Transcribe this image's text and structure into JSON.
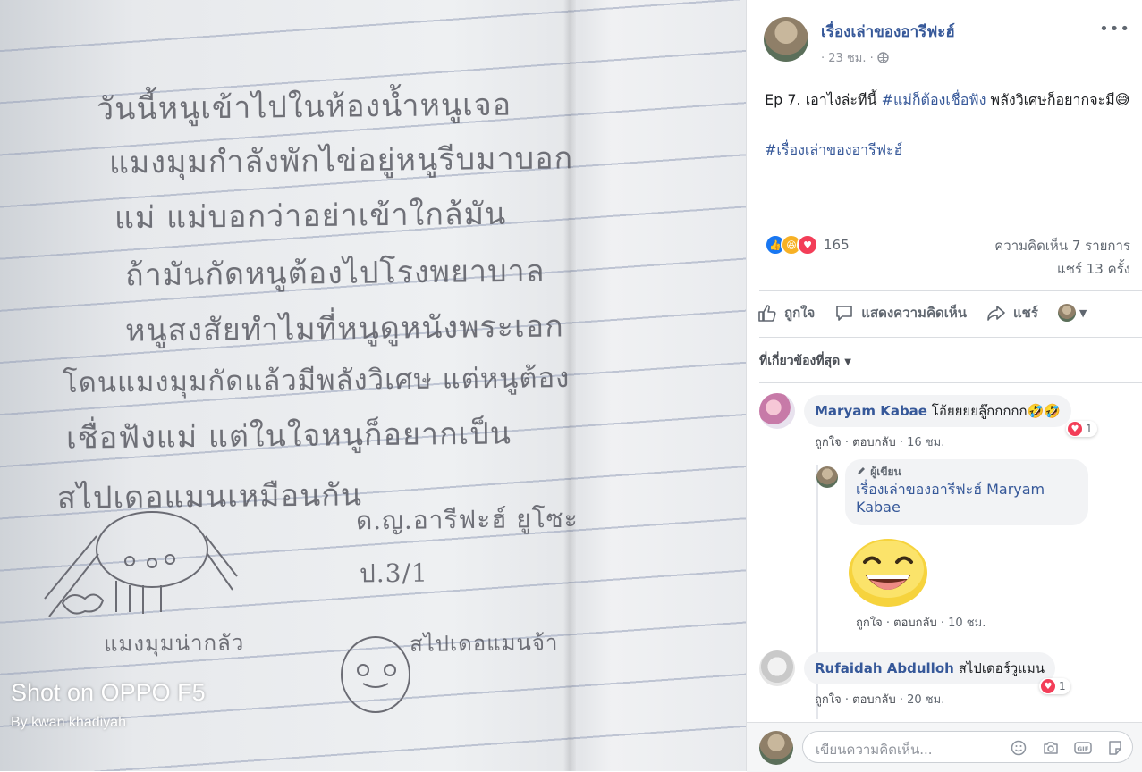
{
  "photo": {
    "handwriting_lines": [
      "วันนี้หนูเข้าไปในห้องน้ำหนูเจอ",
      "แมงมุมกำลังพักไข่อยู่หนูรีบมาบอก",
      "แม่ แม่บอกว่าอย่าเข้าใกล้มัน",
      "ถ้ามันกัดหนูต้องไปโรงพยาบาล",
      "หนูสงสัยทำไมที่หนูดูหนังพระเอก",
      "โดนแมงมุมกัดแล้วมีพลังวิเศษ แต่หนูต้อง",
      "เชื่อฟังแม่ แต่ในใจหนูก็อยากเป็น",
      "สไปเดอแมนเหมือนกัน",
      "ด.ญ.อารีฟะฮ์ ยูโซะ",
      "ป.3/1",
      "แมงมุมน่ากลัว",
      "สไปเดอแมนจ้า"
    ],
    "watermark_main": "Shot on OPPO F5",
    "watermark_sub": "By kwan khadiyah"
  },
  "post": {
    "author": "เรื่องเล่าของอารีฟะฮ์",
    "time": "· 23 ชม. ·",
    "more": "•••",
    "text_prefix": "Ep 7. เอาไงล่ะทีนี้ ",
    "text_hashtag": "#แม่ก็ต้องเชื่อฟัง",
    "text_suffix": " พลังวิเศษก็อยากจะมี😅",
    "footer_hashtag": "#เรื่องเล่าของอารีฟะฮ์",
    "reaction_count": "165",
    "comments_count": "ความคิดเห็น 7 รายการ",
    "shares_count": "แชร์ 13 ครั้ง"
  },
  "actions": {
    "like": "ถูกใจ",
    "comment": "แสดงความคิดเห็น",
    "share": "แชร์"
  },
  "sort": {
    "label": "ที่เกี่ยวข้องที่สุด"
  },
  "comments": [
    {
      "author": "Maryam Kabae",
      "text": "โอ้ยยยยลู๊กกกกก🤣🤣",
      "like": "ถูกใจ",
      "reply": "ตอบกลับ",
      "time": "16 ชม.",
      "heart_count": "1"
    },
    {
      "author_tag": "ผู้เขียน",
      "author": "เรื่องเล่าของอารีฟะฮ์",
      "mention_1": "Maryam",
      "mention_2": "Kabae",
      "like": "ถูกใจ",
      "reply": "ตอบกลับ",
      "time": "10 ชม."
    },
    {
      "author": "Rufaidah Abdulloh",
      "text": "สไปเดอร์วูแมน",
      "like": "ถูกใจ",
      "reply": "ตอบกลับ",
      "time": "20 ชม.",
      "heart_count": "1"
    }
  ],
  "composer": {
    "placeholder": "เขียนความคิดเห็น..."
  },
  "colors": {
    "link": "#365899",
    "like_blue": "#1877f2",
    "heart": "#f33e58",
    "haha": "#f7b125"
  }
}
